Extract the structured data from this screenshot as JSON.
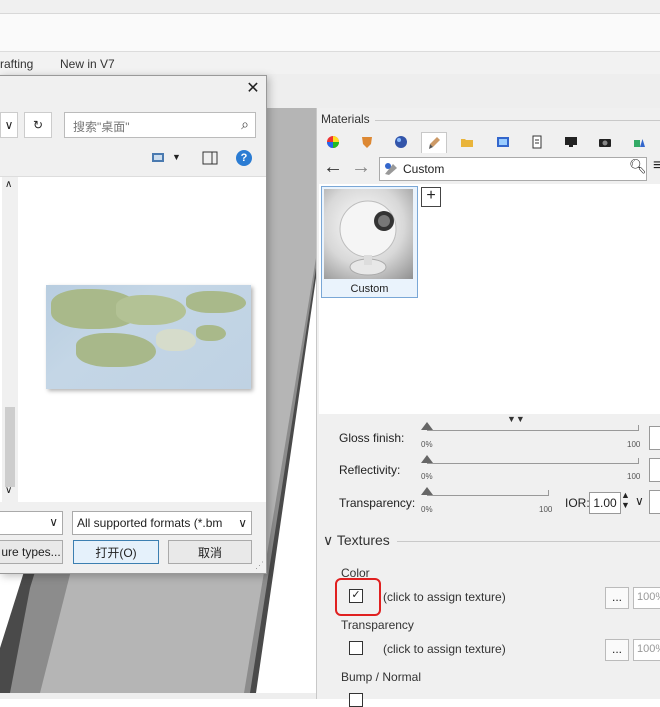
{
  "app": {
    "tabs": [
      "rafting",
      "New in V7"
    ]
  },
  "dialog": {
    "search_placeholder": "搜索\"桌面\"",
    "filter_label": "All supported formats (*.bm",
    "buttons": {
      "texture_types": "ure types...",
      "open": "打开(O)",
      "cancel": "取消"
    }
  },
  "materials": {
    "title": "Materials",
    "breadcrumb": "Custom",
    "swatch_label": "Custom",
    "properties": [
      {
        "label": "Gloss finish:",
        "min": "0%",
        "max": "100"
      },
      {
        "label": "Reflectivity:",
        "min": "0%",
        "max": "100"
      },
      {
        "label": "Transparency:",
        "min": "0%",
        "max": "100"
      }
    ],
    "ior_label": "IOR:",
    "ior_value": "1.00",
    "textures_heading": "Textures",
    "textures": [
      {
        "name": "Color",
        "checked": true,
        "hint": "(click to assign texture)",
        "pct": "100%"
      },
      {
        "name": "Transparency",
        "checked": false,
        "hint": "(click to assign texture)",
        "pct": "100%"
      },
      {
        "name": "Bump / Normal",
        "checked": false
      }
    ],
    "dots": "..."
  },
  "colors": {
    "accent": "#2b7cd3",
    "highlight_circle": "#e02020"
  },
  "icons": {
    "close": "close-icon",
    "search": "search-icon",
    "refresh": "refresh-icon",
    "help": "help-icon"
  }
}
